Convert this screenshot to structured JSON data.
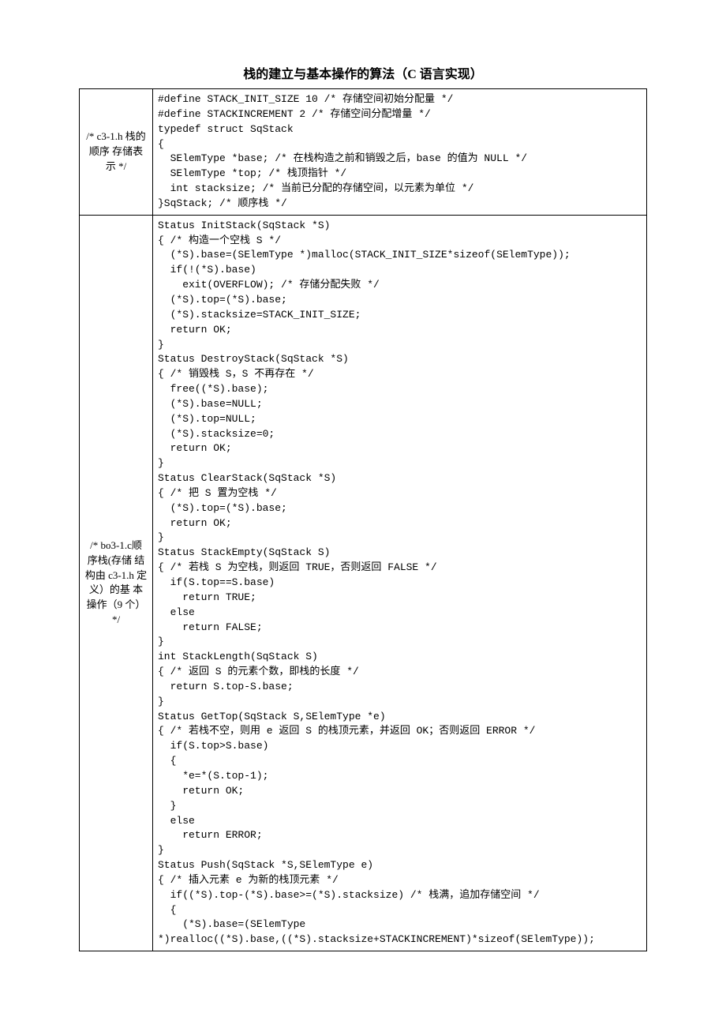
{
  "title": "栈的建立与基本操作的算法（C 语言实现）",
  "rows": [
    {
      "label": "/* c3-1.h\n栈的顺序\n存储表示\n*/",
      "code": "#define STACK_INIT_SIZE 10 /* 存储空间初始分配量 */\n#define STACKINCREMENT 2 /* 存储空间分配增量 */\ntypedef struct SqStack\n{\n  SElemType *base; /* 在栈构造之前和销毁之后，base 的值为 NULL */\n  SElemType *top; /* 栈顶指针 */\n  int stacksize; /* 当前已分配的存储空间，以元素为单位 */\n}SqStack; /* 顺序栈 */"
    },
    {
      "label": "/*\nbo3-1.c顺\n序栈(存储\n结构由\nc3-1.h 定\n义）的基\n本操作（9\n个） */",
      "code": "Status InitStack(SqStack *S)\n{ /* 构造一个空栈 S */\n  (*S).base=(SElemType *)malloc(STACK_INIT_SIZE*sizeof(SElemType));\n  if(!(*S).base)\n    exit(OVERFLOW); /* 存储分配失败 */\n  (*S).top=(*S).base;\n  (*S).stacksize=STACK_INIT_SIZE;\n  return OK;\n}\nStatus DestroyStack(SqStack *S)\n{ /* 销毁栈 S，S 不再存在 */\n  free((*S).base);\n  (*S).base=NULL;\n  (*S).top=NULL;\n  (*S).stacksize=0;\n  return OK;\n}\nStatus ClearStack(SqStack *S)\n{ /* 把 S 置为空栈 */\n  (*S).top=(*S).base;\n  return OK;\n}\nStatus StackEmpty(SqStack S)\n{ /* 若栈 S 为空栈，则返回 TRUE，否则返回 FALSE */\n  if(S.top==S.base)\n    return TRUE;\n  else\n    return FALSE;\n}\nint StackLength(SqStack S)\n{ /* 返回 S 的元素个数，即栈的长度 */\n  return S.top-S.base;\n}\nStatus GetTop(SqStack S,SElemType *e)\n{ /* 若栈不空，则用 e 返回 S 的栈顶元素，并返回 OK；否则返回 ERROR */\n  if(S.top>S.base)\n  {\n    *e=*(S.top-1);\n    return OK;\n  }\n  else\n    return ERROR;\n}\nStatus Push(SqStack *S,SElemType e)\n{ /* 插入元素 e 为新的栈顶元素 */\n  if((*S).top-(*S).base>=(*S).stacksize) /* 栈满，追加存储空间 */\n  {\n    (*S).base=(SElemType\n*)realloc((*S).base,((*S).stacksize+STACKINCREMENT)*sizeof(SElemType));"
    }
  ]
}
